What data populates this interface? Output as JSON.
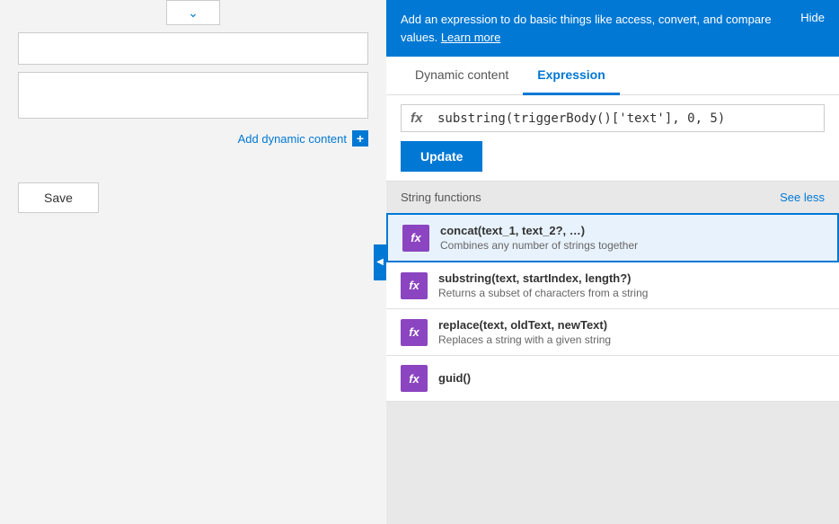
{
  "left": {
    "add_dynamic_label": "Add dynamic content",
    "add_dynamic_plus": "+",
    "save_label": "Save"
  },
  "right": {
    "info_bar": {
      "text": "Add an expression to do basic things like access, convert, and compare values.",
      "learn_more": "Learn more",
      "hide_label": "Hide"
    },
    "tabs": [
      {
        "id": "dynamic",
        "label": "Dynamic content",
        "active": false
      },
      {
        "id": "expression",
        "label": "Expression",
        "active": true
      }
    ],
    "expression": {
      "fx_symbol": "fx",
      "value": "substring(triggerBody()['text'], 0, 5)",
      "update_label": "Update"
    },
    "functions": {
      "section_label": "String functions",
      "see_less_label": "See less",
      "items": [
        {
          "id": "concat",
          "name": "concat(text_1, text_2?, …)",
          "desc": "Combines any number of strings together",
          "selected": true
        },
        {
          "id": "substring",
          "name": "substring(text, startIndex, length?)",
          "desc": "Returns a subset of characters from a string",
          "selected": false
        },
        {
          "id": "replace",
          "name": "replace(text, oldText, newText)",
          "desc": "Replaces a string with a given string",
          "selected": false
        },
        {
          "id": "guid",
          "name": "guid()",
          "desc": "",
          "selected": false
        }
      ]
    }
  }
}
